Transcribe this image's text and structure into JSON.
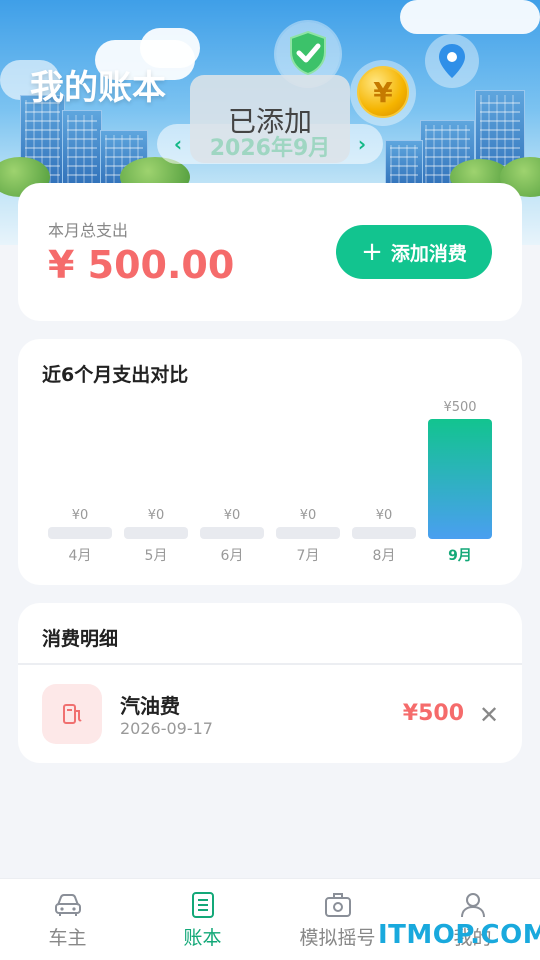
{
  "app": {
    "title": "我的账本"
  },
  "toast": {
    "text": "已添加"
  },
  "month_selector": {
    "current": "2026年9月",
    "prev_icon": "chevron-left-icon",
    "next_icon": "chevron-right-icon"
  },
  "summary": {
    "label": "本月总支出",
    "value": "¥ 500.00",
    "add_button": {
      "label": "添加消费",
      "icon": "plus-icon"
    }
  },
  "chart_card": {
    "title": "近6个月支出对比"
  },
  "chart_data": {
    "type": "bar",
    "categories": [
      "4月",
      "5月",
      "6月",
      "7月",
      "8月",
      "9月"
    ],
    "values": [
      0,
      0,
      0,
      0,
      0,
      500
    ],
    "value_labels": [
      "¥0",
      "¥0",
      "¥0",
      "¥0",
      "¥0",
      "¥500"
    ],
    "highlight_index": 5,
    "colors": {
      "empty": "#e8eaef",
      "highlight_top": "#12c48f",
      "highlight_bottom": "#4a9ff0",
      "label": "#999999",
      "active_label": "#13a878"
    }
  },
  "details": {
    "title": "消费明细",
    "items": [
      {
        "name": "汽油费",
        "date": "2026-09-17",
        "amount": "¥500",
        "icon": "fuel-icon"
      }
    ]
  },
  "nav": {
    "items": [
      {
        "label": "车主",
        "icon": "car-icon",
        "active": false
      },
      {
        "label": "账本",
        "icon": "ledger-icon",
        "active": true
      },
      {
        "label": "模拟摇号",
        "icon": "lottery-icon",
        "active": false
      },
      {
        "label": "我的",
        "icon": "user-icon",
        "active": false
      }
    ]
  },
  "watermark": "ITMOP.COM",
  "colors": {
    "accent": "#12c48f",
    "expense": "#f56b6b",
    "background": "#f3f5f9"
  }
}
